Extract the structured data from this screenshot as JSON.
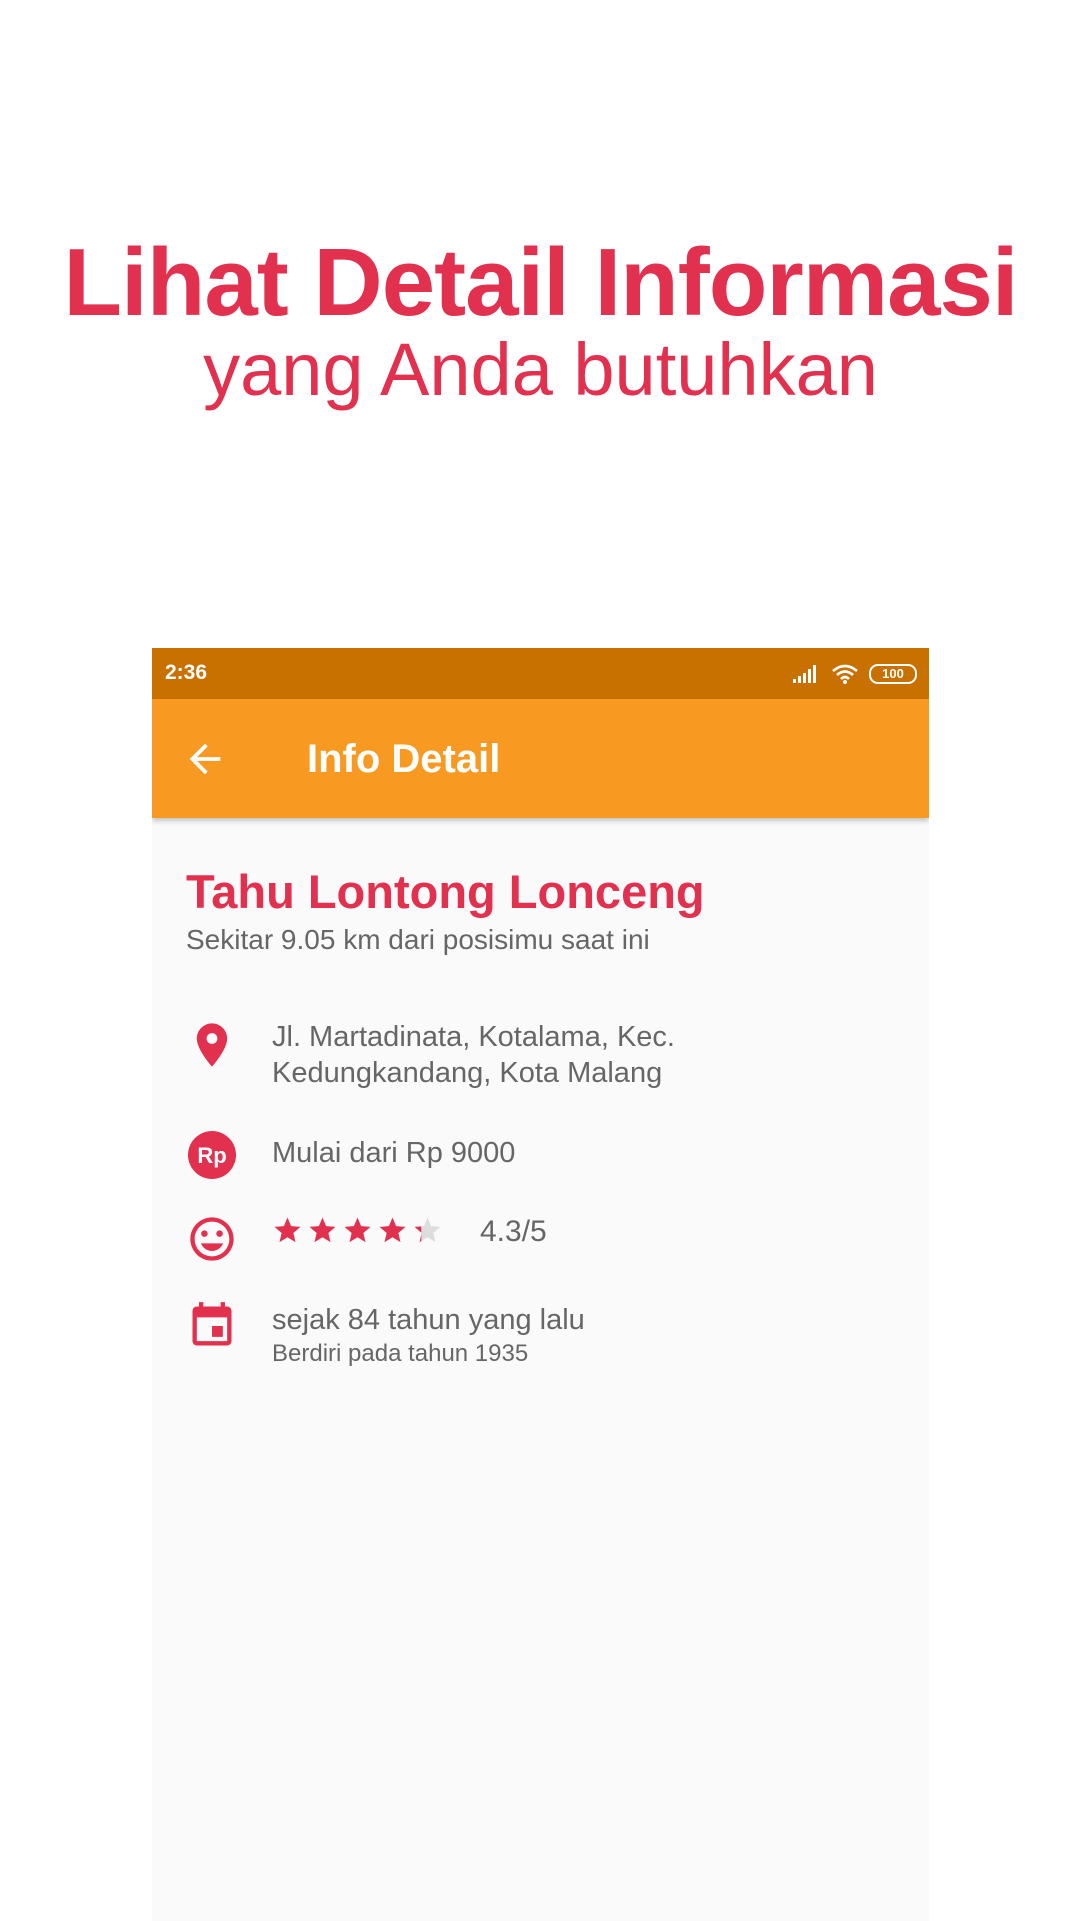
{
  "promo": {
    "title": "Lihat Detail Informasi",
    "subtitle": "yang Anda butuhkan"
  },
  "status_bar": {
    "time": "2:36",
    "battery": "100",
    "icons": [
      "signal-icon",
      "wifi-icon",
      "battery-icon"
    ]
  },
  "app_bar": {
    "back_icon": "arrow-back-icon",
    "title": "Info Detail"
  },
  "detail": {
    "name": "Tahu Lontong Lonceng",
    "distance": "Sekitar 9.05 km dari posisimu saat ini",
    "address_line1": "Jl. Martadinata, Kotalama, Kec.",
    "address_line2": "Kedungkandang, Kota Malang",
    "price": "Mulai dari Rp 9000",
    "price_icon_text": "Rp",
    "rating_value": 4.3,
    "rating_max": 5,
    "rating_text": "4.3/5",
    "since": "sejak 84 tahun yang lalu",
    "founded": "Berdiri pada tahun 1935"
  },
  "colors": {
    "accent": "#e2304f",
    "status_bar": "#c97100",
    "app_bar": "#f89a21",
    "text_secondary": "#666666"
  }
}
